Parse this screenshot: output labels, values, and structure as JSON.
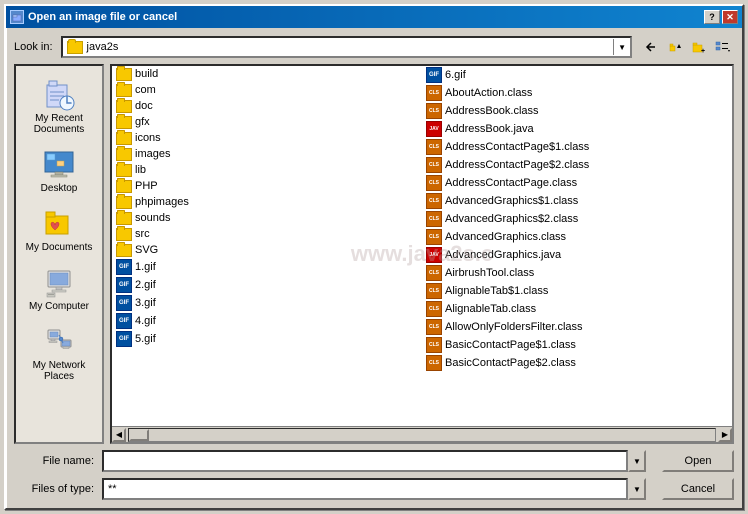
{
  "dialog": {
    "title": "Open an image file or cancel",
    "look_in_label": "Look in:",
    "current_folder": "java2s",
    "file_name_label": "File name:",
    "file_name_value": "",
    "files_of_type_label": "Files of type:",
    "files_of_type_value": "**",
    "open_button": "Open",
    "cancel_button": "Cancel",
    "watermark": "www.java2s.c"
  },
  "sidebar": {
    "items": [
      {
        "id": "recent",
        "label": "My Recent\nDocuments",
        "icon": "clock"
      },
      {
        "id": "desktop",
        "label": "Desktop",
        "icon": "desktop"
      },
      {
        "id": "mydocs",
        "label": "My Documents",
        "icon": "folder-heart"
      },
      {
        "id": "mypc",
        "label": "My Computer",
        "icon": "computer"
      },
      {
        "id": "network",
        "label": "My Network\nPlaces",
        "icon": "network"
      }
    ]
  },
  "files_left": [
    {
      "name": "build",
      "type": "folder"
    },
    {
      "name": "com",
      "type": "folder"
    },
    {
      "name": "doc",
      "type": "folder"
    },
    {
      "name": "gfx",
      "type": "folder"
    },
    {
      "name": "icons",
      "type": "folder"
    },
    {
      "name": "images",
      "type": "folder"
    },
    {
      "name": "lib",
      "type": "folder"
    },
    {
      "name": "PHP",
      "type": "folder"
    },
    {
      "name": "phpimages",
      "type": "folder"
    },
    {
      "name": "sounds",
      "type": "folder"
    },
    {
      "name": "src",
      "type": "folder"
    },
    {
      "name": "SVG",
      "type": "folder"
    },
    {
      "name": "1.gif",
      "type": "gif"
    },
    {
      "name": "2.gif",
      "type": "gif"
    },
    {
      "name": "3.gif",
      "type": "gif"
    },
    {
      "name": "4.gif",
      "type": "gif"
    },
    {
      "name": "5.gif",
      "type": "gif"
    }
  ],
  "files_right": [
    {
      "name": "6.gif",
      "type": "gif"
    },
    {
      "name": "AboutAction.class",
      "type": "class"
    },
    {
      "name": "AddressBook.class",
      "type": "class"
    },
    {
      "name": "AddressBook.java",
      "type": "java"
    },
    {
      "name": "AddressContactPage$1.class",
      "type": "class"
    },
    {
      "name": "AddressContactPage$2.class",
      "type": "class"
    },
    {
      "name": "AddressContactPage.class",
      "type": "class"
    },
    {
      "name": "AdvancedGraphics$1.class",
      "type": "class"
    },
    {
      "name": "AdvancedGraphics$2.class",
      "type": "class"
    },
    {
      "name": "AdvancedGraphics.class",
      "type": "class"
    },
    {
      "name": "AdvancedGraphics.java",
      "type": "java"
    },
    {
      "name": "AirbrushTool.class",
      "type": "class"
    },
    {
      "name": "AlignableTab$1.class",
      "type": "class"
    },
    {
      "name": "AlignableTab.class",
      "type": "class"
    },
    {
      "name": "AllowOnlyFoldersFilter.class",
      "type": "class"
    },
    {
      "name": "BasicContactPage$1.class",
      "type": "class"
    },
    {
      "name": "BasicContactPage$2.class",
      "type": "class"
    }
  ],
  "toolbar": {
    "back_label": "←",
    "up_label": "↑",
    "new_folder_label": "📁",
    "view_label": "☰"
  }
}
